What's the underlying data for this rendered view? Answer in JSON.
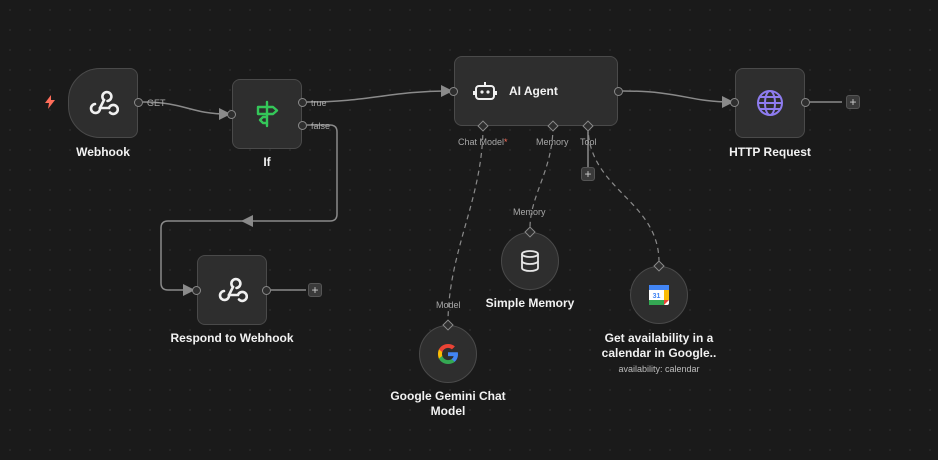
{
  "workflow": {
    "webhook": {
      "label": "Webhook",
      "port_label": "GET"
    },
    "if_node": {
      "label": "If",
      "true_label": "true",
      "false_label": "false"
    },
    "ai_agent": {
      "label": "AI Agent",
      "chat_model_label": "Chat Model",
      "required_mark": "*",
      "memory_label": "Memory",
      "tool_label": "Tool"
    },
    "http_request": {
      "label": "HTTP Request"
    },
    "respond_webhook": {
      "label": "Respond to Webhook"
    },
    "simple_memory": {
      "label": "Simple Memory",
      "port_label": "Memory"
    },
    "gemini": {
      "label_line1": "Google Gemini Chat",
      "label_line2": "Model",
      "port_label": "Model"
    },
    "calendar": {
      "label_line1": "Get availability in a",
      "label_line2": "calendar in Google..",
      "subtitle": "availability: calendar",
      "day_number": "31"
    },
    "add_symbol": "+"
  },
  "colors": {
    "trigger_bolt": "#ff6d5a",
    "if_icon": "#34c759",
    "globe_icon": "#8e7cf0",
    "google_blue": "#4285f4",
    "google_red": "#ea4335",
    "google_yellow": "#fbbc05",
    "google_green": "#34a853"
  }
}
